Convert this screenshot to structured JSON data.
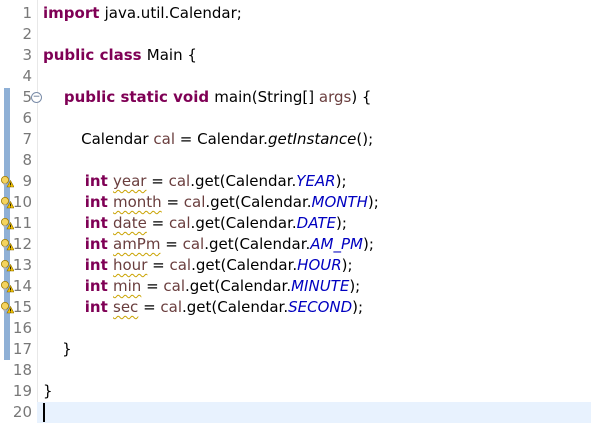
{
  "editor": {
    "language": "java",
    "current_line": 20,
    "lines": [
      {
        "n": "1",
        "segments": [
          {
            "t": "import ",
            "c": "kw"
          },
          {
            "t": "java.util.Calendar;",
            "c": ""
          }
        ]
      },
      {
        "n": "2",
        "segments": []
      },
      {
        "n": "3",
        "segments": [
          {
            "t": "public ",
            "c": "kw"
          },
          {
            "t": "class ",
            "c": "kw"
          },
          {
            "t": "Main {",
            "c": ""
          }
        ]
      },
      {
        "n": "4",
        "segments": []
      },
      {
        "n": "5",
        "fold": true,
        "segments": [
          {
            "t": "    public ",
            "c": "kw"
          },
          {
            "t": "static ",
            "c": "kw"
          },
          {
            "t": "void ",
            "c": "kw"
          },
          {
            "t": "main(String[] ",
            "c": ""
          },
          {
            "t": "args",
            "c": "var"
          },
          {
            "t": ") {",
            "c": ""
          }
        ]
      },
      {
        "n": "6",
        "segments": []
      },
      {
        "n": "7",
        "segments": [
          {
            "t": "        Calendar ",
            "c": ""
          },
          {
            "t": "cal",
            "c": "var"
          },
          {
            "t": " = Calendar.",
            "c": ""
          },
          {
            "t": "getInstance",
            "c": "meth"
          },
          {
            "t": "();",
            "c": ""
          }
        ]
      },
      {
        "n": "8",
        "segments": []
      },
      {
        "n": "9",
        "warning": true,
        "segments": [
          {
            "t": "        int ",
            "c": "kw"
          },
          {
            "t": "year",
            "c": "var warn"
          },
          {
            "t": " = ",
            "c": ""
          },
          {
            "t": "cal",
            "c": "var"
          },
          {
            "t": ".get(Calendar.",
            "c": ""
          },
          {
            "t": "YEAR",
            "c": "stat"
          },
          {
            "t": ");",
            "c": ""
          }
        ]
      },
      {
        "n": "10",
        "warning": true,
        "segments": [
          {
            "t": "        int ",
            "c": "kw"
          },
          {
            "t": "month",
            "c": "var warn"
          },
          {
            "t": " = ",
            "c": ""
          },
          {
            "t": "cal",
            "c": "var"
          },
          {
            "t": ".get(Calendar.",
            "c": ""
          },
          {
            "t": "MONTH",
            "c": "stat"
          },
          {
            "t": ");",
            "c": ""
          }
        ]
      },
      {
        "n": "11",
        "warning": true,
        "segments": [
          {
            "t": "        int ",
            "c": "kw"
          },
          {
            "t": "date",
            "c": "var warn"
          },
          {
            "t": " = ",
            "c": ""
          },
          {
            "t": "cal",
            "c": "var"
          },
          {
            "t": ".get(Calendar.",
            "c": ""
          },
          {
            "t": "DATE",
            "c": "stat"
          },
          {
            "t": ");",
            "c": ""
          }
        ]
      },
      {
        "n": "12",
        "warning": true,
        "segments": [
          {
            "t": "        int ",
            "c": "kw"
          },
          {
            "t": "amPm",
            "c": "var warn"
          },
          {
            "t": " = ",
            "c": ""
          },
          {
            "t": "cal",
            "c": "var"
          },
          {
            "t": ".get(Calendar.",
            "c": ""
          },
          {
            "t": "AM_PM",
            "c": "stat"
          },
          {
            "t": ");",
            "c": ""
          }
        ]
      },
      {
        "n": "13",
        "warning": true,
        "segments": [
          {
            "t": "        int ",
            "c": "kw"
          },
          {
            "t": "hour",
            "c": "var warn"
          },
          {
            "t": " = ",
            "c": ""
          },
          {
            "t": "cal",
            "c": "var"
          },
          {
            "t": ".get(Calendar.",
            "c": ""
          },
          {
            "t": "HOUR",
            "c": "stat"
          },
          {
            "t": ");",
            "c": ""
          }
        ]
      },
      {
        "n": "14",
        "warning": true,
        "segments": [
          {
            "t": "        int ",
            "c": "kw"
          },
          {
            "t": "min",
            "c": "var warn"
          },
          {
            "t": " = ",
            "c": ""
          },
          {
            "t": "cal",
            "c": "var"
          },
          {
            "t": ".get(Calendar.",
            "c": ""
          },
          {
            "t": "MINUTE",
            "c": "stat"
          },
          {
            "t": ");",
            "c": ""
          }
        ]
      },
      {
        "n": "15",
        "warning": true,
        "segments": [
          {
            "t": "        int ",
            "c": "kw"
          },
          {
            "t": "sec",
            "c": "var warn"
          },
          {
            "t": " = ",
            "c": ""
          },
          {
            "t": "cal",
            "c": "var"
          },
          {
            "t": ".get(Calendar.",
            "c": ""
          },
          {
            "t": "SECOND",
            "c": "stat"
          },
          {
            "t": ");",
            "c": ""
          }
        ]
      },
      {
        "n": "16",
        "segments": []
      },
      {
        "n": "17",
        "segments": [
          {
            "t": "    }",
            "c": ""
          }
        ]
      },
      {
        "n": "18",
        "segments": []
      },
      {
        "n": "19",
        "segments": [
          {
            "t": "}",
            "c": ""
          }
        ]
      },
      {
        "n": "20",
        "segments": []
      }
    ]
  },
  "colors": {
    "keyword": "#7f0055",
    "local_variable": "#6a3e3e",
    "static_field": "#0000c0",
    "line_number": "#787878",
    "current_line_bg": "#e8f2fe",
    "warning_underline": "#c9a200",
    "change_ruler": "#8fb0d6"
  },
  "icons": {
    "warning": "warning-lightbulb-icon",
    "fold": "fold-collapse-icon"
  }
}
